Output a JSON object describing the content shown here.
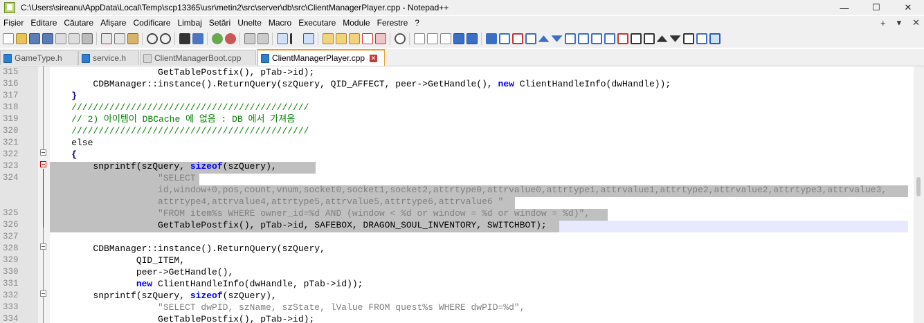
{
  "window": {
    "title": "C:\\Users\\sireanu\\AppData\\Local\\Temp\\scp13365\\usr\\metin2\\src\\server\\db\\src\\ClientManagerPlayer.cpp - Notepad++",
    "minimize": "—",
    "maximize": "☐",
    "close": "✕"
  },
  "menu": {
    "items": [
      "Fișier",
      "Editare",
      "Căutare",
      "Afișare",
      "Codificare",
      "Limbaj",
      "Setări",
      "Unelte",
      "Macro",
      "Executare",
      "Module",
      "Ferestre",
      "?"
    ],
    "plus": "+",
    "chevron": "▾",
    "close": "✕"
  },
  "tabs": [
    {
      "label": "GameType.h"
    },
    {
      "label": "service.h"
    },
    {
      "label": "ClientManagerBoot.cpp"
    },
    {
      "label": "ClientManagerPlayer.cpp"
    }
  ],
  "editor": {
    "lines": [
      {
        "n": "315",
        "code": "                    GetTablePostfix(), pTab->id);"
      },
      {
        "n": "316",
        "code": "        CDBManager::instance().ReturnQuery(szQuery, QID_AFFECT, peer->GetHandle(), new ClientHandleInfo(dwHandle));"
      },
      {
        "n": "317",
        "code": "    }"
      },
      {
        "n": "318",
        "code": "    ////////////////////////////////////////////"
      },
      {
        "n": "319",
        "code": "    // 2) 아이템이 DBCache 에 없음 : DB 에서 가져옴"
      },
      {
        "n": "320",
        "code": "    ////////////////////////////////////////////"
      },
      {
        "n": "321",
        "code": "    else"
      },
      {
        "n": "322",
        "code": "    {"
      },
      {
        "n": "323",
        "code": "        snprintf(szQuery, sizeof(szQuery),"
      },
      {
        "n": "324",
        "code": "                    \"SELECT"
      },
      {
        "n": "",
        "code": "                    id,window+0,pos,count,vnum,socket0,socket1,socket2,attrtype0,attrvalue0,attrtype1,attrvalue1,attrtype2,attrvalue2,attrtype3,attrvalue3,"
      },
      {
        "n": "",
        "code": "                    attrtype4,attrvalue4,attrtype5,attrvalue5,attrtype6,attrvalue6 \""
      },
      {
        "n": "325",
        "code": "                    \"FROM item%s WHERE owner_id=%d AND (window < %d or window = %d or window = %d)\","
      },
      {
        "n": "326",
        "code": "                    GetTablePostfix(), pTab->id, SAFEBOX, DRAGON_SOUL_INVENTORY, SWITCHBOT);"
      },
      {
        "n": "327",
        "code": ""
      },
      {
        "n": "328",
        "code": "        CDBManager::instance().ReturnQuery(szQuery,"
      },
      {
        "n": "329",
        "code": "                QID_ITEM,"
      },
      {
        "n": "330",
        "code": "                peer->GetHandle(),"
      },
      {
        "n": "331",
        "code": "                new ClientHandleInfo(dwHandle, pTab->id));"
      },
      {
        "n": "332",
        "code": "        snprintf(szQuery, sizeof(szQuery),"
      },
      {
        "n": "333",
        "code": "                    \"SELECT dwPID, szName, szState, lValue FROM quest%s WHERE dwPID=%d\","
      },
      {
        "n": "334",
        "code": "                    GetTablePostfix(), pTab->id);"
      }
    ]
  },
  "colors": {
    "keyword": "#0000ff",
    "comment": "#008000",
    "string": "#808080",
    "selection": "#c0c0c0",
    "current_line": "#e8e8ff",
    "tab_accent": "#f59a23"
  }
}
